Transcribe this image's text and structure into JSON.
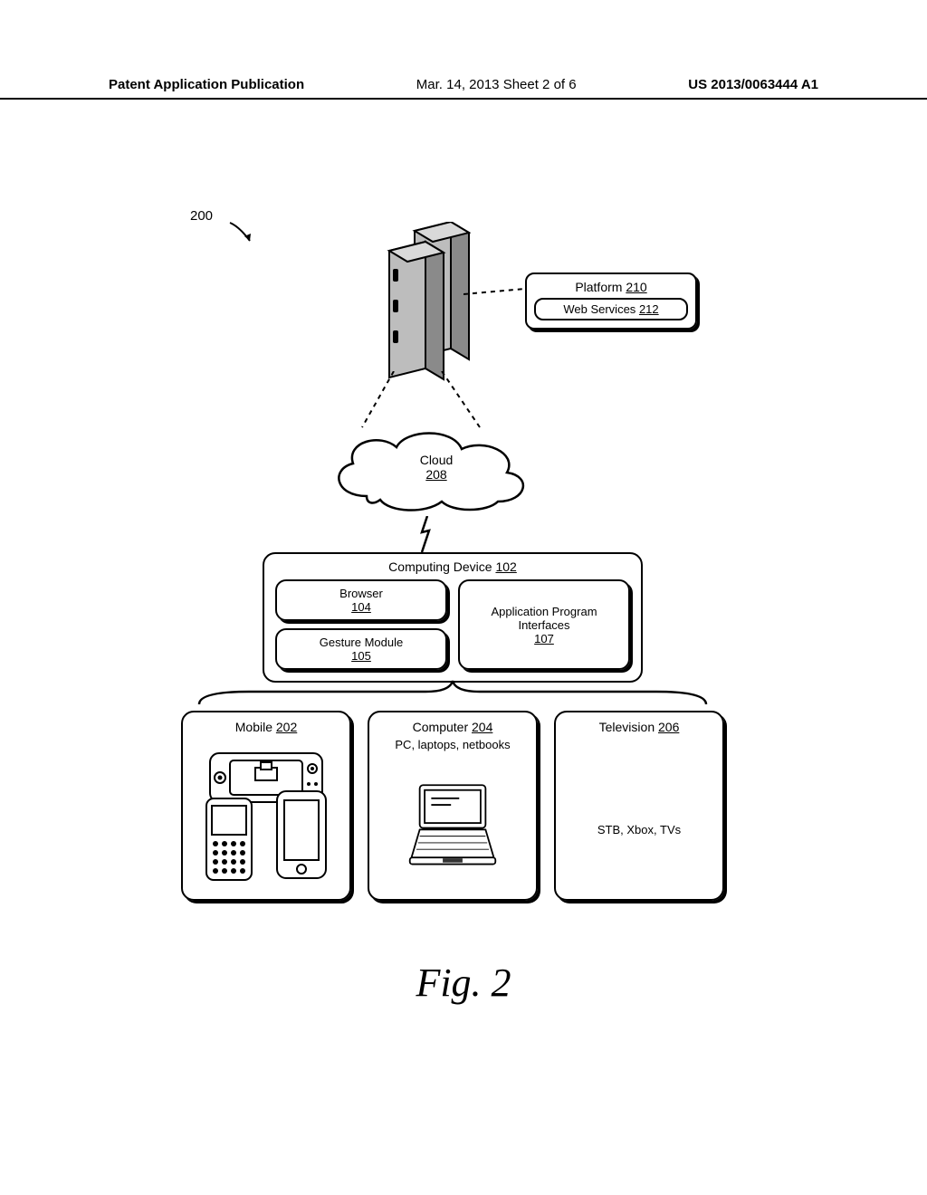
{
  "header": {
    "left": "Patent Application Publication",
    "center": "Mar. 14, 2013  Sheet 2 of 6",
    "right": "US 2013/0063444 A1"
  },
  "figure_caption": "Fig. 2",
  "ref200": "200",
  "platform": {
    "label": "Platform",
    "ref": "210",
    "web_services_label": "Web Services",
    "web_services_ref": "212"
  },
  "cloud": {
    "label": "Cloud",
    "ref": "208"
  },
  "computing_device": {
    "label": "Computing Device",
    "ref": "102",
    "browser_label": "Browser",
    "browser_ref": "104",
    "gesture_label": "Gesture Module",
    "gesture_ref": "105",
    "api_label": "Application Program Interfaces",
    "api_ref": "107"
  },
  "bottom": {
    "mobile_label": "Mobile",
    "mobile_ref": "202",
    "computer_label": "Computer",
    "computer_ref": "204",
    "computer_sub": "PC, laptops, netbooks",
    "tv_label": "Television",
    "tv_ref": "206",
    "tv_sub": "STB, Xbox, TVs"
  }
}
